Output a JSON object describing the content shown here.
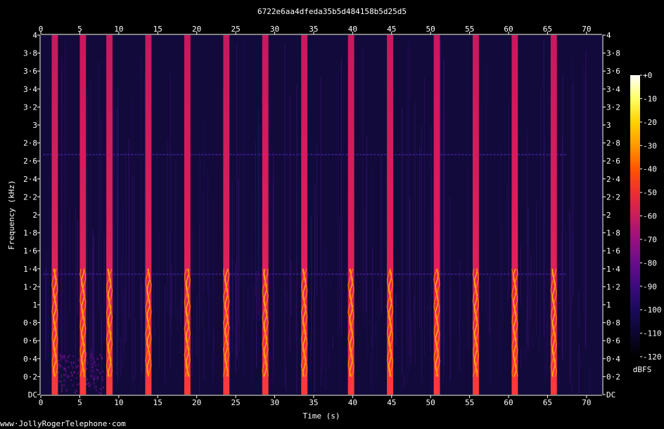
{
  "chart_data": {
    "type": "heatmap",
    "title": "6722e6aa4dfeda35b5d484158b5d25d5",
    "xlabel": "Time (s)",
    "ylabel": "Frequency (kHz)",
    "xlim": [
      0,
      72
    ],
    "ylim": [
      0,
      4
    ],
    "x_ticks": [
      "0",
      "5",
      "10",
      "15",
      "20",
      "25",
      "30",
      "35",
      "40",
      "45",
      "50",
      "55",
      "60",
      "65",
      "70"
    ],
    "y_ticks": [
      "DC",
      "0·2",
      "0·4",
      "0·6",
      "0·8",
      "1",
      "1·2",
      "1·4",
      "1·6",
      "1·8",
      "2",
      "2·2",
      "2·4",
      "2·6",
      "2·8",
      "3",
      "3·2",
      "3·4",
      "3·6",
      "3·8",
      "4"
    ],
    "colorbar": {
      "label": "dBFS",
      "range": [
        -120,
        0
      ],
      "ticks": [
        "+0",
        "-10",
        "-20",
        "-30",
        "-40",
        "-50",
        "-60",
        "-70",
        "-80",
        "-90",
        "-100",
        "-110",
        "-120"
      ],
      "colors": [
        "#000000",
        "#0d0630",
        "#1a0a5c",
        "#3d0a80",
        "#6a0c8c",
        "#990f80",
        "#c81c5c",
        "#ee2e30",
        "#ff5500",
        "#ff9900",
        "#ffd200",
        "#ffff66",
        "#ffffff"
      ]
    },
    "tone_bursts": [
      {
        "start": 1.4,
        "end": 2.2
      },
      {
        "start": 5.0,
        "end": 5.8
      },
      {
        "start": 8.4,
        "end": 9.2
      },
      {
        "start": 13.4,
        "end": 14.2
      },
      {
        "start": 18.4,
        "end": 19.2
      },
      {
        "start": 23.4,
        "end": 24.2
      },
      {
        "start": 28.4,
        "end": 29.2
      },
      {
        "start": 33.4,
        "end": 34.2
      },
      {
        "start": 39.4,
        "end": 40.2
      },
      {
        "start": 44.4,
        "end": 45.2
      },
      {
        "start": 50.4,
        "end": 51.2
      },
      {
        "start": 55.4,
        "end": 56.2
      },
      {
        "start": 60.4,
        "end": 61.2
      },
      {
        "start": 65.4,
        "end": 66.2
      }
    ],
    "tone_burst_level_dbfs": -45,
    "speech_band_khz": [
      0.2,
      1.4
    ],
    "speech_peak_level_dbfs": -20,
    "noise_floor_dbfs": -110,
    "hum_lines_khz": [
      2.67,
      1.34
    ],
    "grid": false
  },
  "footer": {
    "credit": "www·JollyRogerTelephone·com"
  }
}
